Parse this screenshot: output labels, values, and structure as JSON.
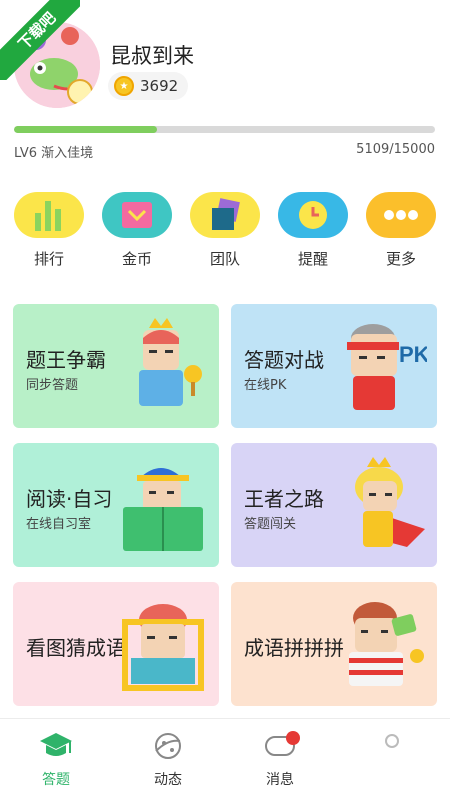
{
  "watermark": {
    "text": "下载吧"
  },
  "profile": {
    "username": "昆叔到来",
    "coins": "3692",
    "level": "LV6 渐入佳境",
    "exp": "5109/15000",
    "exp_progress": 0.34
  },
  "quick_actions": [
    {
      "label": "排行",
      "icon": "ranking-bars-icon",
      "color": "#fbe54a"
    },
    {
      "label": "金币",
      "icon": "gold-coin-box-icon",
      "color": "#3fc6c3"
    },
    {
      "label": "团队",
      "icon": "team-cards-icon",
      "color": "#fbe54a"
    },
    {
      "label": "提醒",
      "icon": "clock-icon",
      "color": "#38b8e6"
    },
    {
      "label": "更多",
      "icon": "more-dots-icon",
      "color": "#fbbf2b"
    }
  ],
  "cards": [
    {
      "title": "题王争霸",
      "subtitle": "同步答题",
      "bg": "#b8f0c8"
    },
    {
      "title": "答题对战",
      "subtitle": "在线PK",
      "bg": "#bfe3f6"
    },
    {
      "title": "阅读·自习",
      "subtitle": "在线自习室",
      "bg": "#b0f0d8"
    },
    {
      "title": "王者之路",
      "subtitle": "答题闯关",
      "bg": "#d8d4f6"
    },
    {
      "title": "看图猜成语",
      "subtitle": "",
      "bg": "#fde0e6"
    },
    {
      "title": "成语拼拼拼",
      "subtitle": "",
      "bg": "#fde2cf"
    }
  ],
  "nav": [
    {
      "label": "答题",
      "active": true
    },
    {
      "label": "动态",
      "active": false
    },
    {
      "label": "消息",
      "active": false
    },
    {
      "label": "",
      "active": false
    }
  ]
}
